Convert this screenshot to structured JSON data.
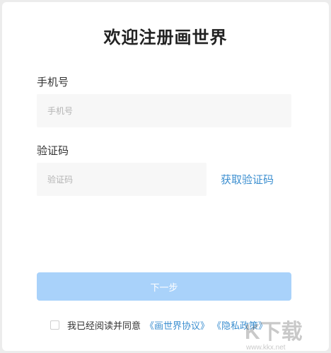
{
  "title": "欢迎注册画世界",
  "phone": {
    "label": "手机号",
    "placeholder": "手机号",
    "value": ""
  },
  "code": {
    "label": "验证码",
    "placeholder": "验证码",
    "value": "",
    "get_code_label": "获取验证码"
  },
  "next_button": "下一步",
  "agreement": {
    "checked": false,
    "text": "我已经阅读并同意",
    "links": [
      "《画世界协议》",
      "《隐私政策》"
    ]
  },
  "watermark": {
    "text": "K下载",
    "url": "www.kkx.net"
  },
  "colors": {
    "accent": "#3c8fd0",
    "button_disabled": "#a9d2fa",
    "input_bg": "#f7f7f7"
  }
}
